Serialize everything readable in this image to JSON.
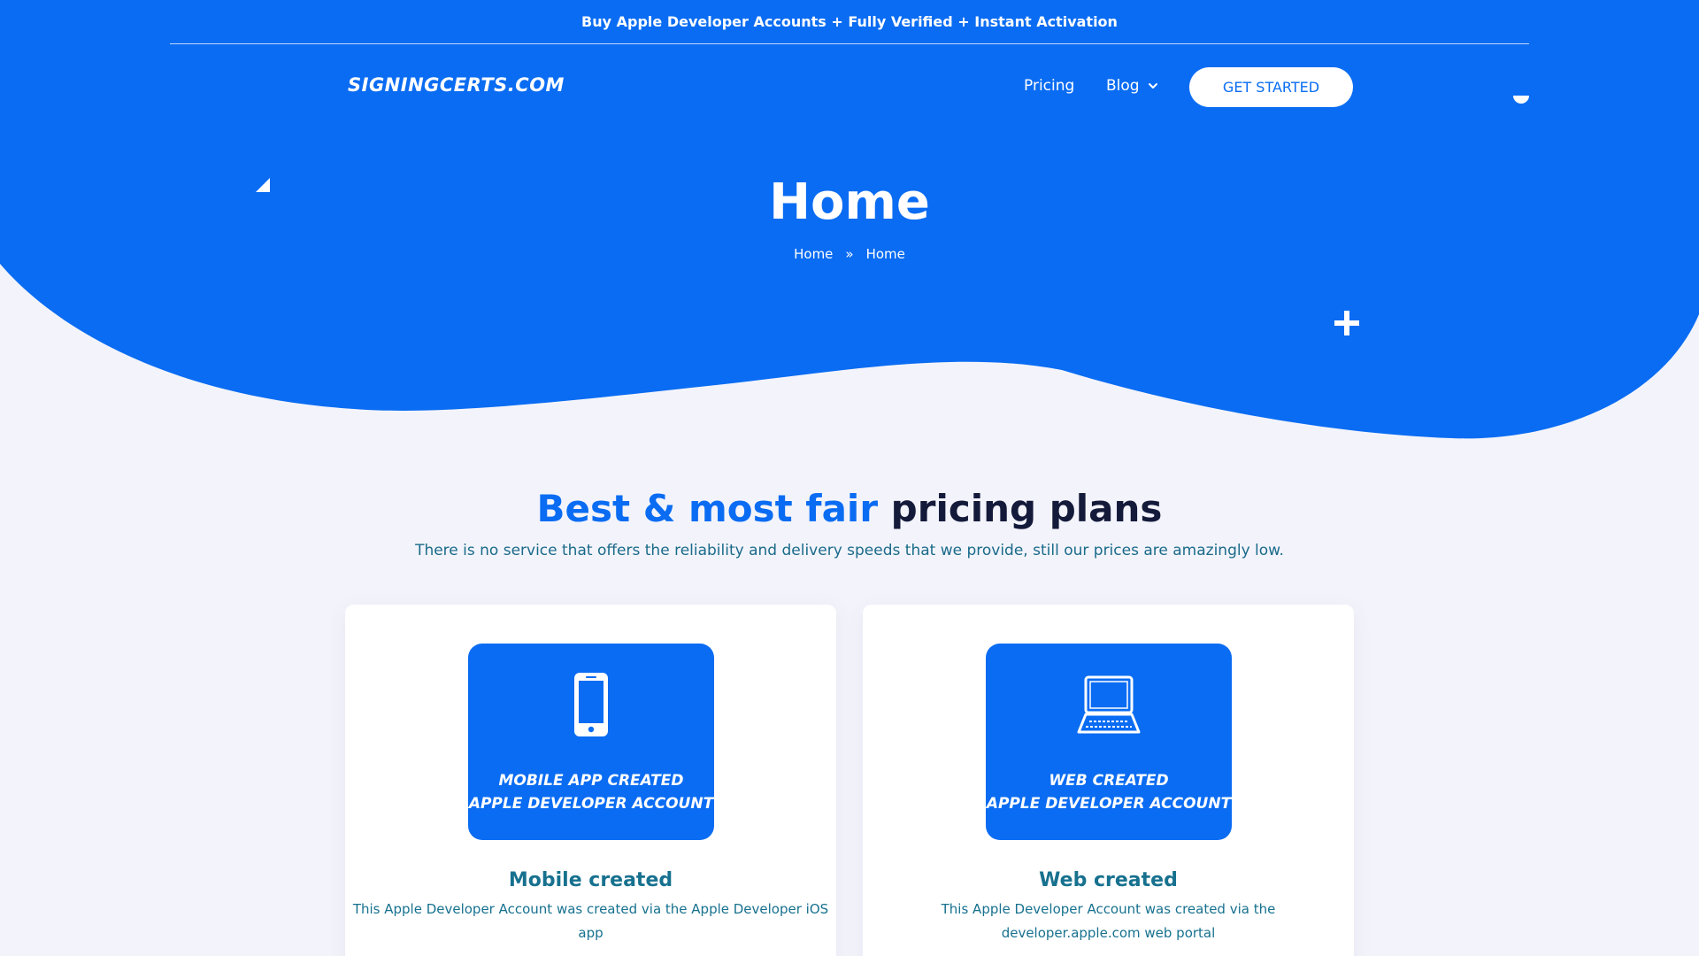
{
  "colors": {
    "brand_blue": "#0a6cf2",
    "page_background": "#f3f4fb",
    "heading_dark": "#141a3a",
    "teal_text": "#17718f"
  },
  "topbar": {
    "announcement": "Buy Apple Developer Accounts + Fully Verified + Instant Activation"
  },
  "header": {
    "logo_text": "SIGNINGCERTS.COM",
    "nav": {
      "pricing": "Pricing",
      "blog": "Blog"
    },
    "cta_label": "GET STARTED"
  },
  "hero": {
    "title": "Home",
    "breadcrumb": {
      "home": "Home",
      "separator": "»",
      "current": "Home"
    }
  },
  "pricing_section": {
    "title_accent": "Best & most fair",
    "title_rest": "pricing plans",
    "subtitle": "There is no service that offers the reliability and delivery speeds that we provide, still our prices are amazingly low."
  },
  "cards": [
    {
      "icon": "smartphone-icon",
      "image_line1": "MOBILE APP CREATED",
      "image_line2": "APPLE DEVELOPER ACCOUNT",
      "title": "Mobile created",
      "description": "This Apple Developer Account was created via the Apple Developer iOS app"
    },
    {
      "icon": "laptop-icon",
      "image_line1": "WEB CREATED",
      "image_line2": "APPLE DEVELOPER ACCOUNT",
      "title": "Web created",
      "description": "This Apple Developer Account was created via the developer.apple.com web portal"
    }
  ]
}
